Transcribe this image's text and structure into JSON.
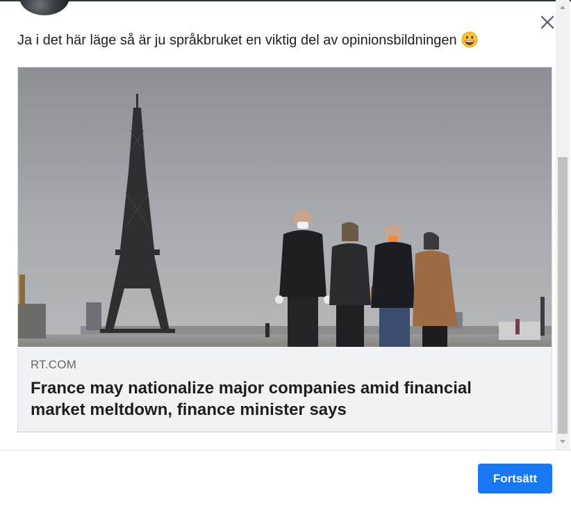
{
  "post": {
    "text": "Ja i det här läge så är ju språkbruket en viktig del av opinionsbildningen",
    "emoji": "grinning-face"
  },
  "link_card": {
    "domain": "RT.COM",
    "title": "France may nationalize major companies amid financial market meltdown, finance minister says",
    "image_description_icon": "photo-eiffel-tower-pedestrians"
  },
  "dialog": {
    "close_icon": "close-icon",
    "continue_label": "Fortsätt"
  },
  "colors": {
    "accent": "#1877f2",
    "text": "#1c1e21",
    "muted": "#65676b",
    "card_bg": "#f0f2f5"
  }
}
